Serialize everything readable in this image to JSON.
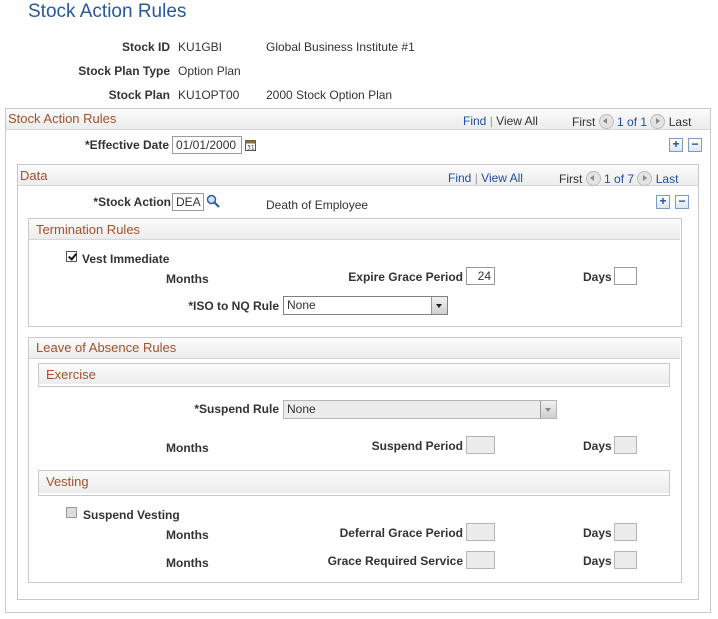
{
  "page_title": "Stock Action Rules",
  "header": {
    "stock_id_label": "Stock ID",
    "stock_id": "KU1GBI",
    "stock_id_desc": "Global Business Institute #1",
    "plan_type_label": "Stock Plan Type",
    "plan_type": "Option Plan",
    "stock_plan_label": "Stock Plan",
    "stock_plan": "KU1OPT00",
    "stock_plan_desc": "2000 Stock Option Plan"
  },
  "outer": {
    "title": "Stock Action Rules",
    "find": "Find",
    "sep": "|",
    "view_all": "View All",
    "first": "First",
    "range": "1 of 1",
    "last": "Last",
    "effective_date_label": "*Effective Date",
    "effective_date": "01/01/2000",
    "add": "+",
    "remove": "−"
  },
  "data": {
    "title": "Data",
    "find": "Find",
    "sep": "|",
    "view_all": "View All",
    "first": "First",
    "range": "1 of 7",
    "last": "Last",
    "stock_action_label": "*Stock Action",
    "stock_action": "DEA",
    "stock_action_desc": "Death of Employee",
    "add": "+",
    "remove": "−"
  },
  "termination": {
    "title": "Termination Rules",
    "vest_immediate_label": "Vest Immediate",
    "vest_immediate_checked": true,
    "months_label": "Months",
    "expire_label": "Expire Grace Period",
    "expire_value": "24",
    "days_label": "Days",
    "days_value": "",
    "iso_label": "*ISO to NQ Rule",
    "iso_value": "None"
  },
  "leave": {
    "title": "Leave of Absence Rules",
    "exercise": {
      "title": "Exercise",
      "suspend_rule_label": "*Suspend Rule",
      "suspend_rule_value": "None",
      "months_label": "Months",
      "suspend_period_label": "Suspend Period",
      "days_label": "Days"
    },
    "vesting": {
      "title": "Vesting",
      "suspend_vesting_label": "Suspend Vesting",
      "months_label_1": "Months",
      "deferral_label": "Deferral Grace Period",
      "days_label_1": "Days",
      "months_label_2": "Months",
      "grace_required_label": "Grace Required Service",
      "days_label_2": "Days"
    }
  }
}
